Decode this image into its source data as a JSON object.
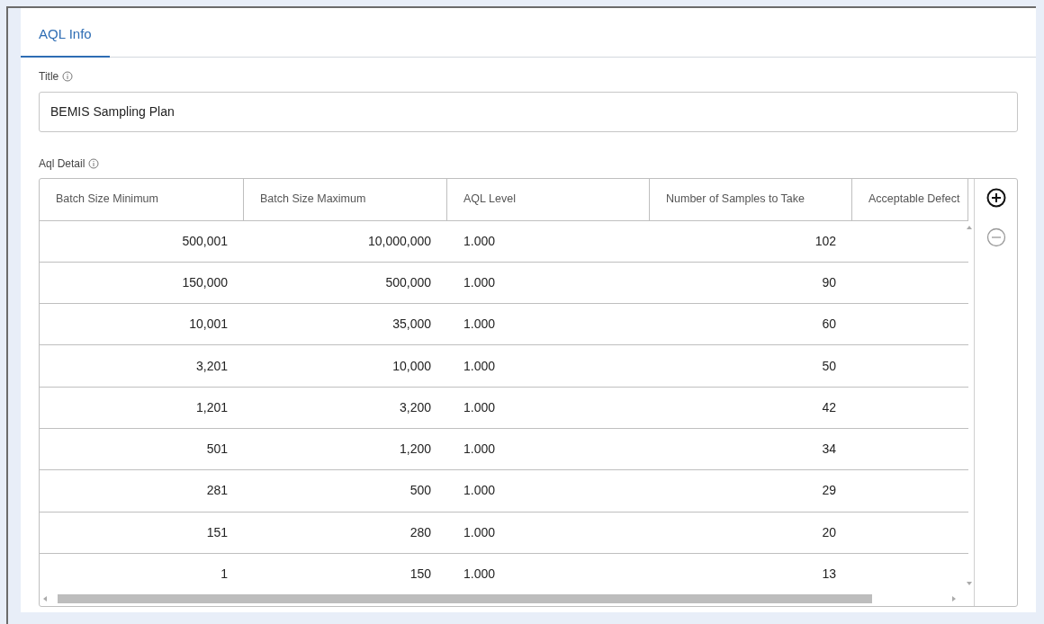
{
  "tabs": [
    {
      "label": "AQL Info",
      "selected": true
    }
  ],
  "title_field": {
    "label": "Title",
    "value": "BEMIS Sampling Plan"
  },
  "aql_detail": {
    "label": "Aql Detail",
    "columns": [
      {
        "label": "Batch Size Minimum",
        "kind": "number"
      },
      {
        "label": "Batch Size Maximum",
        "kind": "number"
      },
      {
        "label": "AQL Level",
        "kind": "text"
      },
      {
        "label": "Number of Samples to Take",
        "kind": "number"
      },
      {
        "label": "Acceptable Defect",
        "kind": "number"
      }
    ],
    "rows": [
      [
        "500,001",
        "10,000,000",
        "1.000",
        "102"
      ],
      [
        "150,000",
        "500,000",
        "1.000",
        "90"
      ],
      [
        "10,001",
        "35,000",
        "1.000",
        "60"
      ],
      [
        "3,201",
        "10,000",
        "1.000",
        "50"
      ],
      [
        "1,201",
        "3,200",
        "1.000",
        "42"
      ],
      [
        "501",
        "1,200",
        "1.000",
        "34"
      ],
      [
        "281",
        "500",
        "1.000",
        "29"
      ],
      [
        "151",
        "280",
        "1.000",
        "20"
      ],
      [
        "1",
        "150",
        "1.000",
        "13"
      ]
    ],
    "actions": [
      {
        "kind": "add",
        "disabled": false
      },
      {
        "kind": "remove",
        "disabled": true
      }
    ]
  }
}
